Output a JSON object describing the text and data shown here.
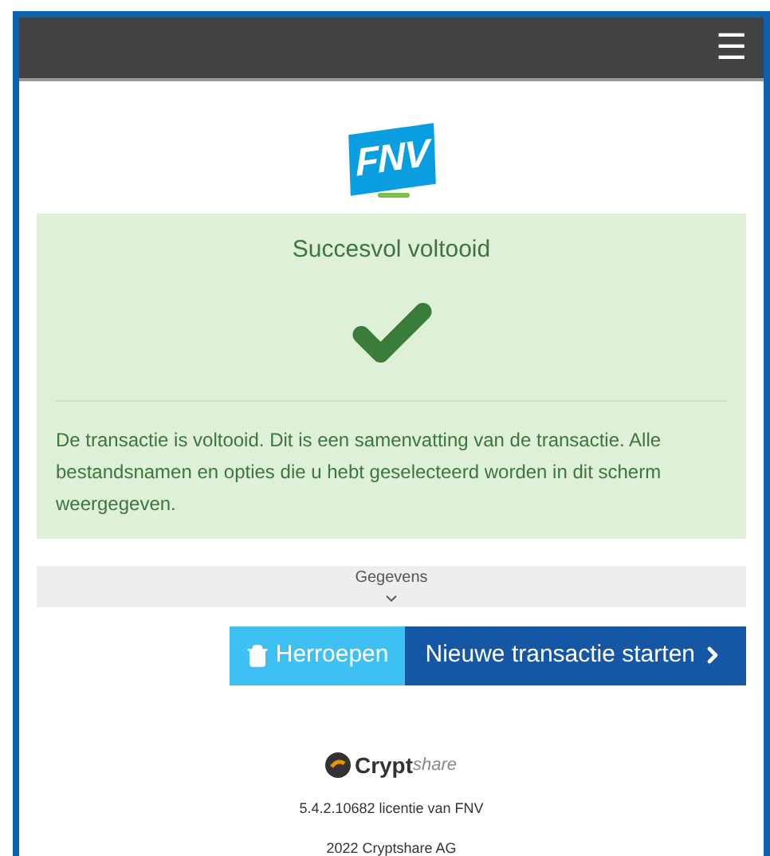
{
  "header": {
    "menu": "☰"
  },
  "logo": {
    "text": "FNV"
  },
  "result": {
    "title": "Succesvol voltooid",
    "message": "De transactie is voltooid. Dit is een samenvatting van de transactie. Alle bestandsnamen en opties die u hebt geselecteerd worden in dit scherm weergegeven."
  },
  "details": {
    "label": "Gegevens",
    "expanded": false
  },
  "buttons": [
    {
      "kind": "revoke",
      "label": "Herroepen"
    },
    {
      "kind": "next",
      "label": "Nieuwe transactie starten"
    }
  ],
  "footer": {
    "brand_bold": "Crypt",
    "brand_light": "share",
    "version": "5.4.2.10682 licentie van FNV",
    "copyright": "2022 Cryptshare AG"
  }
}
